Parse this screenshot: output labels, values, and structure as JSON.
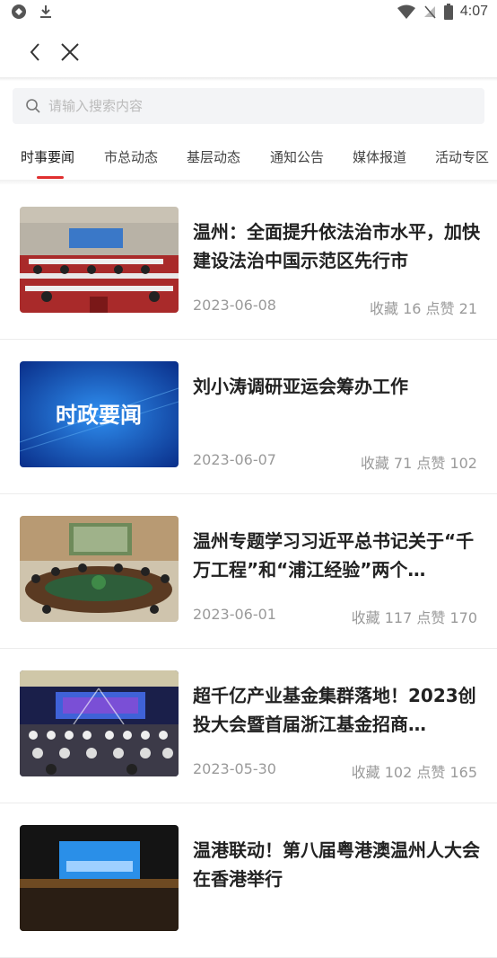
{
  "status": {
    "time": "4:07"
  },
  "search": {
    "placeholder": "请输入搜索内容"
  },
  "tabs": [
    "时事要闻",
    "市总动态",
    "基层动态",
    "通知公告",
    "媒体报道",
    "活动专区"
  ],
  "colors": {
    "accent": "#e02f2f"
  },
  "articles": [
    {
      "title": "温州：全面提升依法治市水平，加快建设法治中国示范区先行市",
      "date": "2023-06-08",
      "stats": "收藏 16 点赞 21",
      "thumb": "meeting-hall"
    },
    {
      "title": "刘小涛调研亚运会筹办工作",
      "date": "2023-06-07",
      "stats": "收藏 71 点赞 102",
      "thumb_text": "时政要闻"
    },
    {
      "title": "温州专题学习习近平总书记关于“千万工程”和“浦江经验”两个…",
      "date": "2023-06-01",
      "stats": "收藏 117 点赞 170",
      "thumb": "round-table"
    },
    {
      "title": "超千亿产业基金集群落地！2023创投大会暨首届浙江基金招商…",
      "date": "2023-05-30",
      "stats": "收藏 102 点赞 165",
      "thumb": "conference-stage"
    },
    {
      "title": "温港联动！第八届粤港澳温州人大会在香港举行",
      "date": "",
      "stats": "",
      "thumb": "stage-screen"
    }
  ]
}
